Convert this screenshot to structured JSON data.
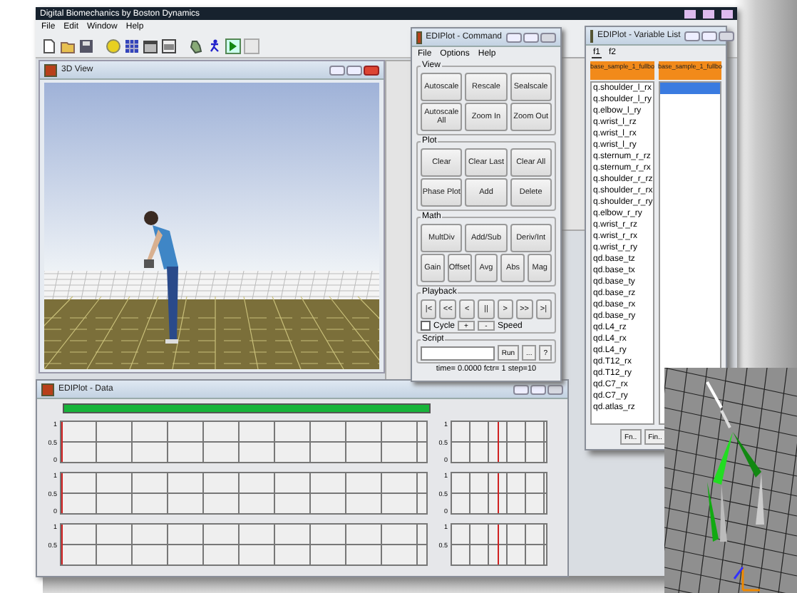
{
  "app": {
    "title": "Digital Biomechanics by Boston Dynamics",
    "menu": [
      "File",
      "Edit",
      "Window",
      "Help"
    ]
  },
  "view3d": {
    "title": "3D View"
  },
  "command": {
    "title": "EDIPlot - Command",
    "menu": [
      "File",
      "Options",
      "Help"
    ],
    "groups": [
      {
        "kind": "buttons",
        "label": "View",
        "rows": [
          {
            "buttons": [
              "Autoscale",
              "Rescale",
              "Sealscale"
            ]
          },
          {
            "buttons": [
              "Autoscale All",
              "Zoom In",
              "Zoom Out"
            ]
          }
        ]
      },
      {
        "kind": "buttons",
        "label": "Plot",
        "rows": [
          {
            "buttons": [
              "Clear",
              "Clear Last",
              "Clear All"
            ]
          },
          {
            "buttons": [
              "Phase Plot",
              "Add",
              "Delete"
            ]
          }
        ]
      },
      {
        "kind": "buttons",
        "label": "Math",
        "rows": [
          {
            "buttons": [
              "MultDiv",
              "Add/Sub",
              "Deriv/Int"
            ]
          },
          {
            "buttons": [
              "Gain",
              "Offset",
              "Avg",
              "Abs",
              "Mag"
            ]
          }
        ]
      },
      {
        "kind": "playback",
        "label": "Playback",
        "rows": [
          {
            "buttons": [
              "|<",
              "<<",
              "<",
              "||",
              ">",
              ">>",
              ">|"
            ]
          }
        ],
        "cycle": {
          "label": "Cycle",
          "checked": false
        },
        "speed_buttons": [
          "+",
          "-"
        ],
        "speed_label": "Speed"
      },
      {
        "kind": "script",
        "label": "Script",
        "buttons": [
          "Run",
          "...",
          "?"
        ]
      }
    ],
    "status": "time= 0.0000 fctr= 1 step=10"
  },
  "variables": {
    "title": "EDIPlot - Variable List",
    "tabs": [
      {
        "label": "f1",
        "selected": true
      },
      {
        "label": "f2",
        "selected": false
      }
    ],
    "columns": [
      {
        "header": "base_sample_1_fullbo",
        "items": [
          {
            "text": "q.shoulder_l_rx",
            "selected": false
          },
          {
            "text": "q.shoulder_l_ry",
            "selected": false
          },
          {
            "text": "q.elbow_l_ry",
            "selected": false
          },
          {
            "text": "q.wrist_l_rz",
            "selected": false
          },
          {
            "text": "q.wrist_l_rx",
            "selected": false
          },
          {
            "text": "q.wrist_l_ry",
            "selected": false
          },
          {
            "text": "q.sternum_r_rz",
            "selected": false
          },
          {
            "text": "q.sternum_r_rx",
            "selected": false
          },
          {
            "text": "q.shoulder_r_rz",
            "selected": false
          },
          {
            "text": "q.shoulder_r_rx",
            "selected": false
          },
          {
            "text": "q.shoulder_r_ry",
            "selected": false
          },
          {
            "text": "q.elbow_r_ry",
            "selected": false
          },
          {
            "text": "q.wrist_r_rz",
            "selected": false
          },
          {
            "text": "q.wrist_r_rx",
            "selected": false
          },
          {
            "text": "q.wrist_r_ry",
            "selected": false
          },
          {
            "text": "qd.base_tz",
            "selected": false
          },
          {
            "text": "qd.base_tx",
            "selected": false
          },
          {
            "text": "qd.base_ty",
            "selected": false
          },
          {
            "text": "qd.base_rz",
            "selected": false
          },
          {
            "text": "qd.base_rx",
            "selected": false
          },
          {
            "text": "qd.base_ry",
            "selected": false
          },
          {
            "text": "qd.L4_rz",
            "selected": false
          },
          {
            "text": "qd.L4_rx",
            "selected": false
          },
          {
            "text": "qd.L4_ry",
            "selected": false
          },
          {
            "text": "qd.T12_rx",
            "selected": false
          },
          {
            "text": "qd.T12_ry",
            "selected": false
          },
          {
            "text": "qd.C7_rx",
            "selected": false
          },
          {
            "text": "qd.C7_ry",
            "selected": false
          },
          {
            "text": "qd.atlas_rz",
            "selected": false
          }
        ]
      },
      {
        "header": "base_sample_1_fullbo",
        "items": [
          {
            "selected": true
          }
        ]
      }
    ],
    "buttons": [
      "Fn..",
      "Fin.."
    ]
  },
  "plots": {
    "title": "EDIPlot - Data",
    "timeline": {
      "level": 1
    },
    "rows": [
      {
        "panels": [
          {
            "ticks": [
              "1",
              "0.5",
              "0"
            ]
          },
          {
            "ticks": [
              "1",
              "0.5",
              "0"
            ]
          }
        ]
      },
      {
        "panels": [
          {
            "ticks": [
              "1",
              "0.5",
              "0"
            ]
          },
          {
            "ticks": [
              "1",
              "0.5",
              "0"
            ]
          }
        ]
      },
      {
        "panels": [
          {
            "ticks": [
              "1",
              "0.5"
            ]
          },
          {
            "ticks": [
              "1",
              "0.5"
            ]
          }
        ]
      }
    ]
  }
}
